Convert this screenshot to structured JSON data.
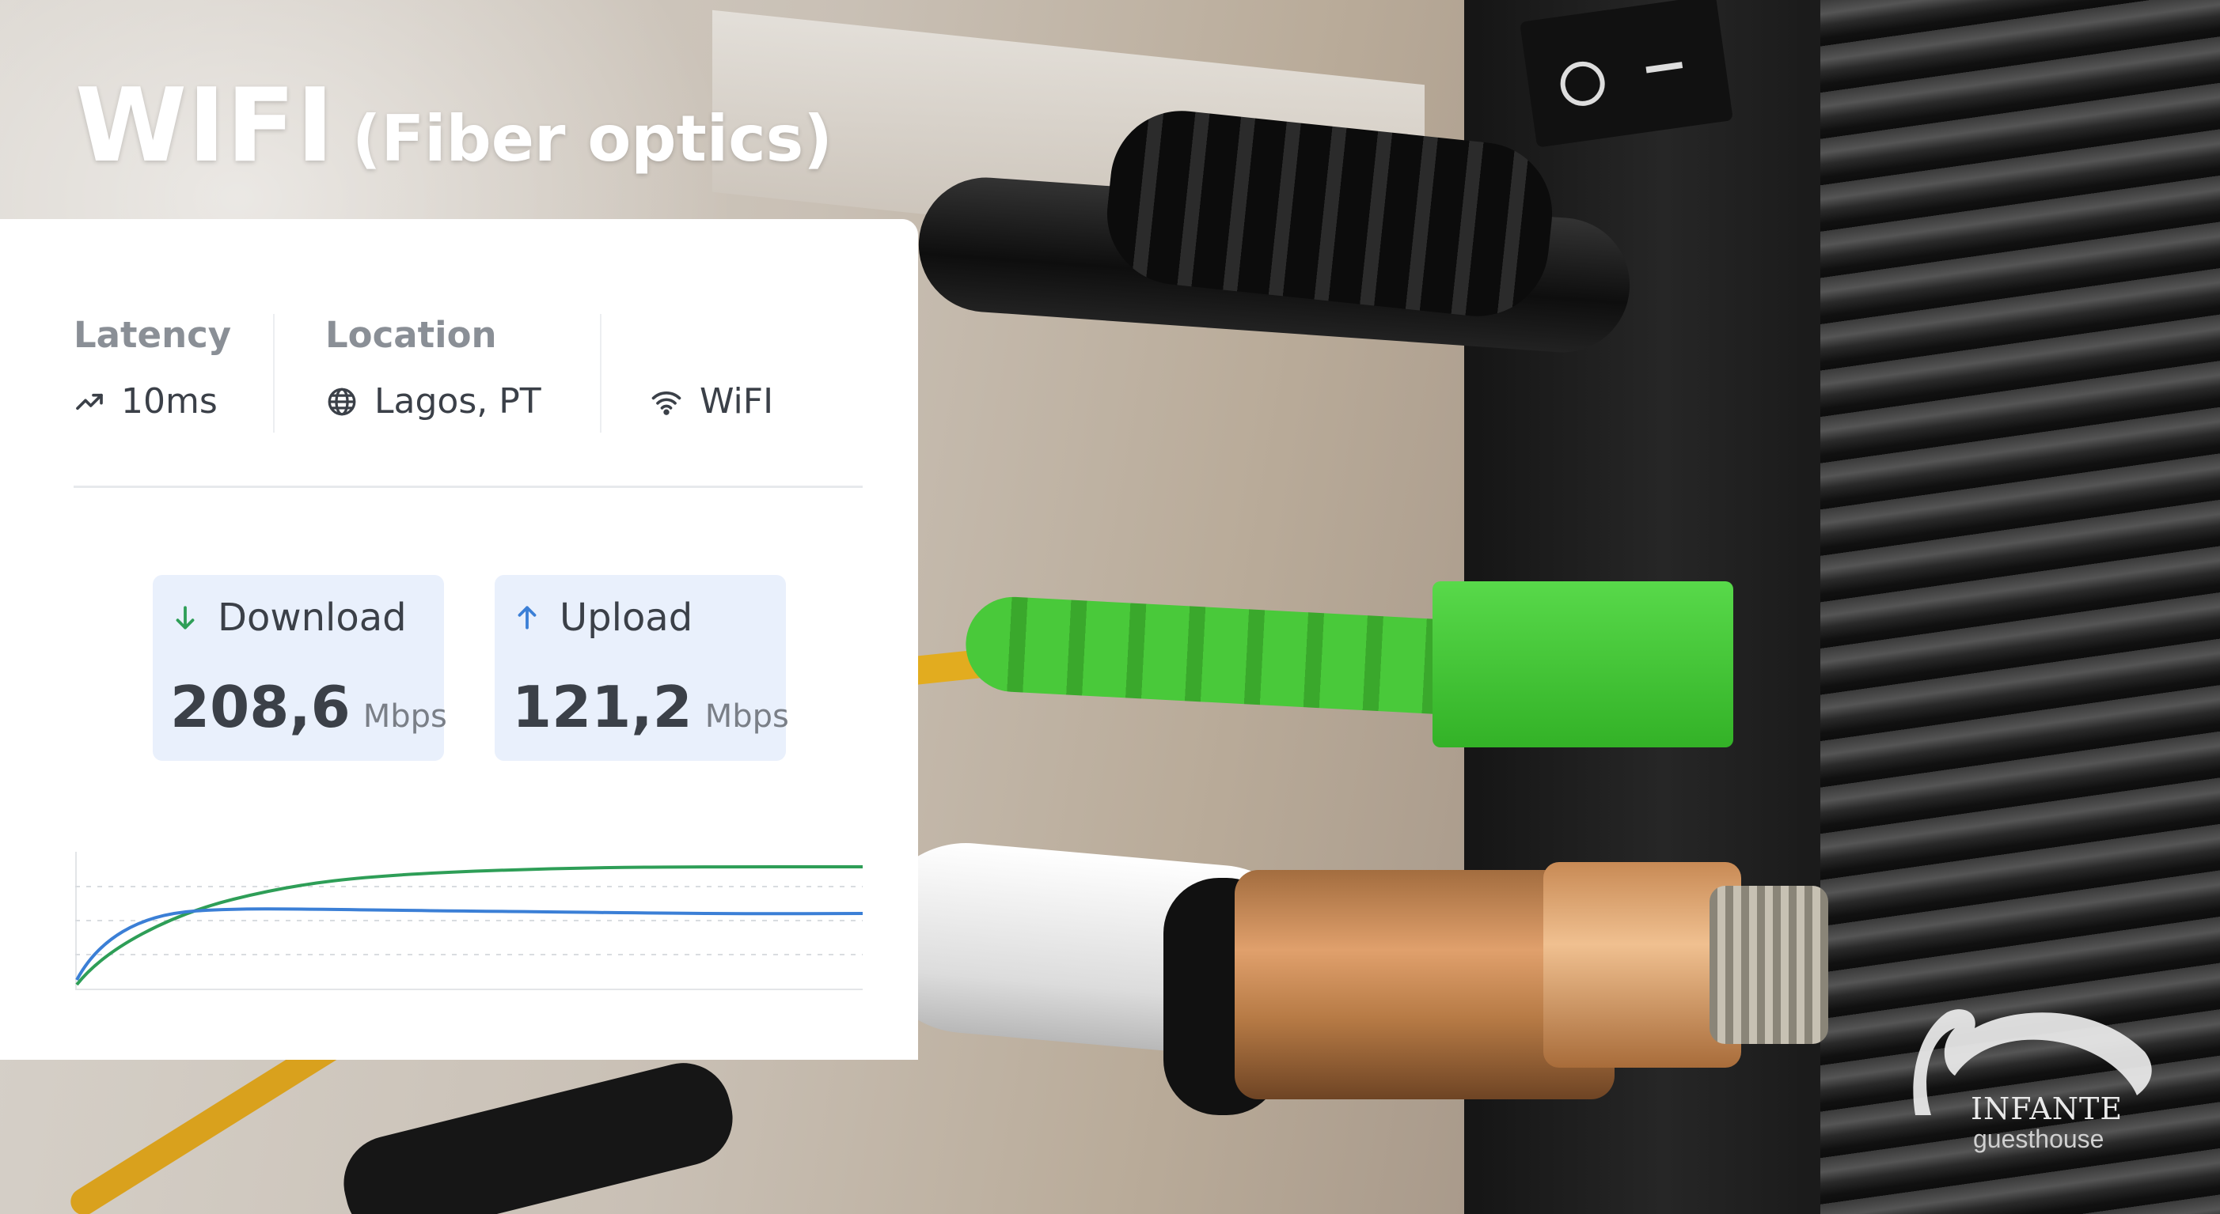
{
  "title": {
    "main": "WIFI",
    "sub": "(Fiber optics)"
  },
  "stats": {
    "latency": {
      "label": "Latency",
      "value": "10ms",
      "icon": "trending-up-icon"
    },
    "location": {
      "label": "Location",
      "value": "Lagos, PT",
      "icon": "globe-icon"
    },
    "connection": {
      "value": "WiFI",
      "icon": "wifi-icon"
    }
  },
  "speed": {
    "download": {
      "label": "Download",
      "value": "208,6",
      "unit": "Mbps",
      "icon": "arrow-down-icon",
      "color": "#2e9e57"
    },
    "upload": {
      "label": "Upload",
      "value": "121,2",
      "unit": "Mbps",
      "icon": "arrow-up-icon",
      "color": "#3b7fd6"
    }
  },
  "logo": {
    "brand": "INFANTE",
    "tag": "guesthouse"
  }
}
